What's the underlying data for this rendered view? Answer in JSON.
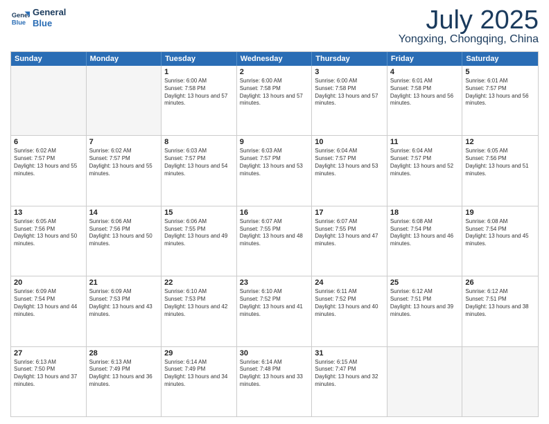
{
  "header": {
    "logo_line1": "General",
    "logo_line2": "Blue",
    "month": "July 2025",
    "location": "Yongxing, Chongqing, China"
  },
  "weekdays": [
    "Sunday",
    "Monday",
    "Tuesday",
    "Wednesday",
    "Thursday",
    "Friday",
    "Saturday"
  ],
  "weeks": [
    [
      {
        "day": "",
        "sunrise": "",
        "sunset": "",
        "daylight": "",
        "empty": true
      },
      {
        "day": "",
        "sunrise": "",
        "sunset": "",
        "daylight": "",
        "empty": true
      },
      {
        "day": "1",
        "sunrise": "Sunrise: 6:00 AM",
        "sunset": "Sunset: 7:58 PM",
        "daylight": "Daylight: 13 hours and 57 minutes.",
        "empty": false
      },
      {
        "day": "2",
        "sunrise": "Sunrise: 6:00 AM",
        "sunset": "Sunset: 7:58 PM",
        "daylight": "Daylight: 13 hours and 57 minutes.",
        "empty": false
      },
      {
        "day": "3",
        "sunrise": "Sunrise: 6:00 AM",
        "sunset": "Sunset: 7:58 PM",
        "daylight": "Daylight: 13 hours and 57 minutes.",
        "empty": false
      },
      {
        "day": "4",
        "sunrise": "Sunrise: 6:01 AM",
        "sunset": "Sunset: 7:58 PM",
        "daylight": "Daylight: 13 hours and 56 minutes.",
        "empty": false
      },
      {
        "day": "5",
        "sunrise": "Sunrise: 6:01 AM",
        "sunset": "Sunset: 7:57 PM",
        "daylight": "Daylight: 13 hours and 56 minutes.",
        "empty": false
      }
    ],
    [
      {
        "day": "6",
        "sunrise": "Sunrise: 6:02 AM",
        "sunset": "Sunset: 7:57 PM",
        "daylight": "Daylight: 13 hours and 55 minutes.",
        "empty": false
      },
      {
        "day": "7",
        "sunrise": "Sunrise: 6:02 AM",
        "sunset": "Sunset: 7:57 PM",
        "daylight": "Daylight: 13 hours and 55 minutes.",
        "empty": false
      },
      {
        "day": "8",
        "sunrise": "Sunrise: 6:03 AM",
        "sunset": "Sunset: 7:57 PM",
        "daylight": "Daylight: 13 hours and 54 minutes.",
        "empty": false
      },
      {
        "day": "9",
        "sunrise": "Sunrise: 6:03 AM",
        "sunset": "Sunset: 7:57 PM",
        "daylight": "Daylight: 13 hours and 53 minutes.",
        "empty": false
      },
      {
        "day": "10",
        "sunrise": "Sunrise: 6:04 AM",
        "sunset": "Sunset: 7:57 PM",
        "daylight": "Daylight: 13 hours and 53 minutes.",
        "empty": false
      },
      {
        "day": "11",
        "sunrise": "Sunrise: 6:04 AM",
        "sunset": "Sunset: 7:57 PM",
        "daylight": "Daylight: 13 hours and 52 minutes.",
        "empty": false
      },
      {
        "day": "12",
        "sunrise": "Sunrise: 6:05 AM",
        "sunset": "Sunset: 7:56 PM",
        "daylight": "Daylight: 13 hours and 51 minutes.",
        "empty": false
      }
    ],
    [
      {
        "day": "13",
        "sunrise": "Sunrise: 6:05 AM",
        "sunset": "Sunset: 7:56 PM",
        "daylight": "Daylight: 13 hours and 50 minutes.",
        "empty": false
      },
      {
        "day": "14",
        "sunrise": "Sunrise: 6:06 AM",
        "sunset": "Sunset: 7:56 PM",
        "daylight": "Daylight: 13 hours and 50 minutes.",
        "empty": false
      },
      {
        "day": "15",
        "sunrise": "Sunrise: 6:06 AM",
        "sunset": "Sunset: 7:55 PM",
        "daylight": "Daylight: 13 hours and 49 minutes.",
        "empty": false
      },
      {
        "day": "16",
        "sunrise": "Sunrise: 6:07 AM",
        "sunset": "Sunset: 7:55 PM",
        "daylight": "Daylight: 13 hours and 48 minutes.",
        "empty": false
      },
      {
        "day": "17",
        "sunrise": "Sunrise: 6:07 AM",
        "sunset": "Sunset: 7:55 PM",
        "daylight": "Daylight: 13 hours and 47 minutes.",
        "empty": false
      },
      {
        "day": "18",
        "sunrise": "Sunrise: 6:08 AM",
        "sunset": "Sunset: 7:54 PM",
        "daylight": "Daylight: 13 hours and 46 minutes.",
        "empty": false
      },
      {
        "day": "19",
        "sunrise": "Sunrise: 6:08 AM",
        "sunset": "Sunset: 7:54 PM",
        "daylight": "Daylight: 13 hours and 45 minutes.",
        "empty": false
      }
    ],
    [
      {
        "day": "20",
        "sunrise": "Sunrise: 6:09 AM",
        "sunset": "Sunset: 7:54 PM",
        "daylight": "Daylight: 13 hours and 44 minutes.",
        "empty": false
      },
      {
        "day": "21",
        "sunrise": "Sunrise: 6:09 AM",
        "sunset": "Sunset: 7:53 PM",
        "daylight": "Daylight: 13 hours and 43 minutes.",
        "empty": false
      },
      {
        "day": "22",
        "sunrise": "Sunrise: 6:10 AM",
        "sunset": "Sunset: 7:53 PM",
        "daylight": "Daylight: 13 hours and 42 minutes.",
        "empty": false
      },
      {
        "day": "23",
        "sunrise": "Sunrise: 6:10 AM",
        "sunset": "Sunset: 7:52 PM",
        "daylight": "Daylight: 13 hours and 41 minutes.",
        "empty": false
      },
      {
        "day": "24",
        "sunrise": "Sunrise: 6:11 AM",
        "sunset": "Sunset: 7:52 PM",
        "daylight": "Daylight: 13 hours and 40 minutes.",
        "empty": false
      },
      {
        "day": "25",
        "sunrise": "Sunrise: 6:12 AM",
        "sunset": "Sunset: 7:51 PM",
        "daylight": "Daylight: 13 hours and 39 minutes.",
        "empty": false
      },
      {
        "day": "26",
        "sunrise": "Sunrise: 6:12 AM",
        "sunset": "Sunset: 7:51 PM",
        "daylight": "Daylight: 13 hours and 38 minutes.",
        "empty": false
      }
    ],
    [
      {
        "day": "27",
        "sunrise": "Sunrise: 6:13 AM",
        "sunset": "Sunset: 7:50 PM",
        "daylight": "Daylight: 13 hours and 37 minutes.",
        "empty": false
      },
      {
        "day": "28",
        "sunrise": "Sunrise: 6:13 AM",
        "sunset": "Sunset: 7:49 PM",
        "daylight": "Daylight: 13 hours and 36 minutes.",
        "empty": false
      },
      {
        "day": "29",
        "sunrise": "Sunrise: 6:14 AM",
        "sunset": "Sunset: 7:49 PM",
        "daylight": "Daylight: 13 hours and 34 minutes.",
        "empty": false
      },
      {
        "day": "30",
        "sunrise": "Sunrise: 6:14 AM",
        "sunset": "Sunset: 7:48 PM",
        "daylight": "Daylight: 13 hours and 33 minutes.",
        "empty": false
      },
      {
        "day": "31",
        "sunrise": "Sunrise: 6:15 AM",
        "sunset": "Sunset: 7:47 PM",
        "daylight": "Daylight: 13 hours and 32 minutes.",
        "empty": false
      },
      {
        "day": "",
        "sunrise": "",
        "sunset": "",
        "daylight": "",
        "empty": true
      },
      {
        "day": "",
        "sunrise": "",
        "sunset": "",
        "daylight": "",
        "empty": true
      }
    ]
  ]
}
